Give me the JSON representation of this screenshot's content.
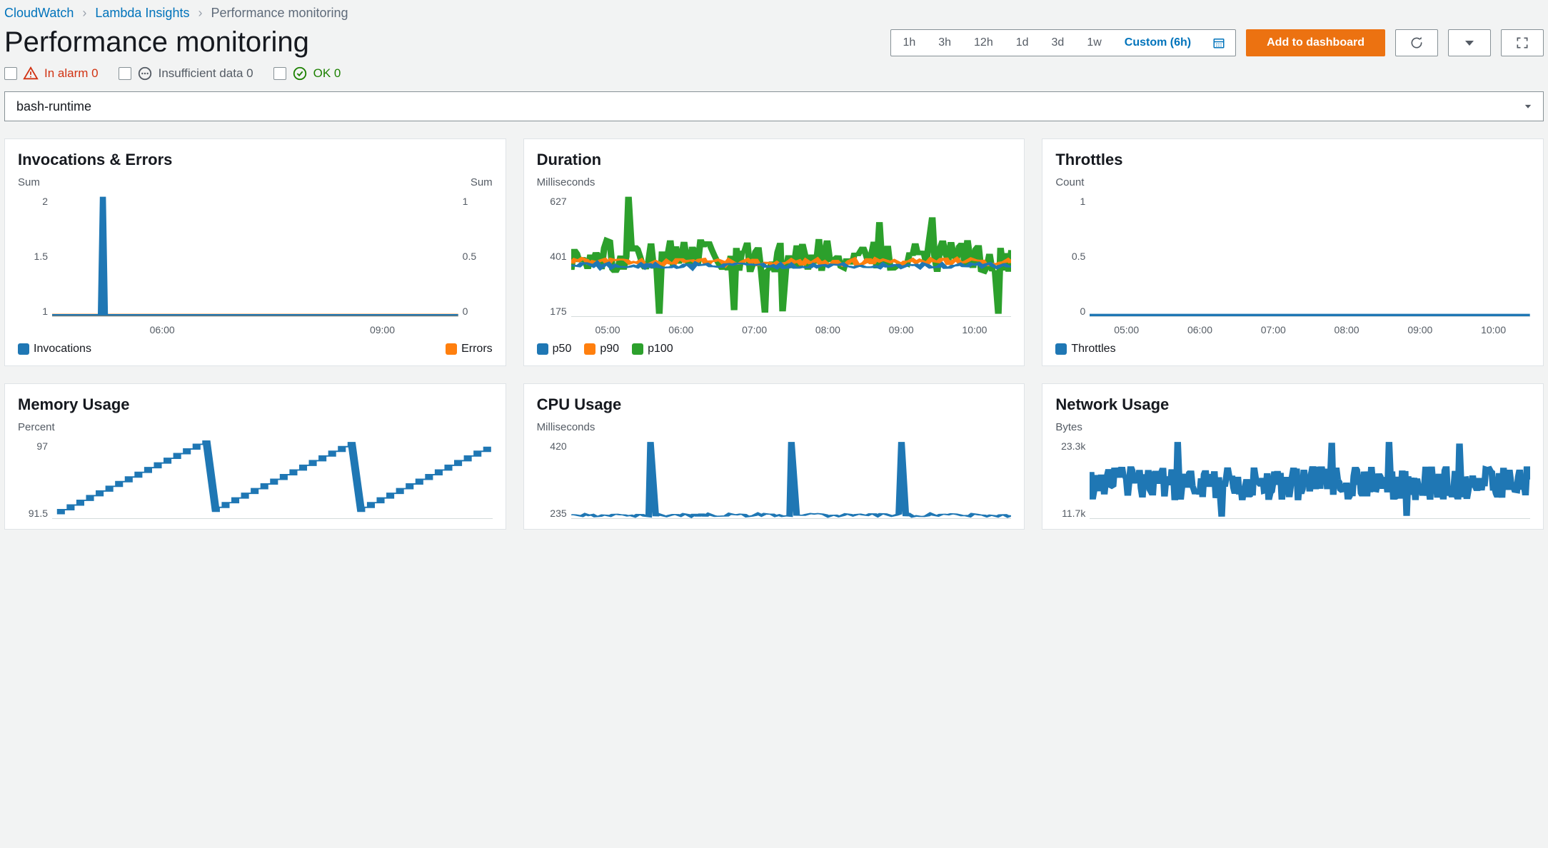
{
  "breadcrumb": {
    "items": [
      "CloudWatch",
      "Lambda Insights"
    ],
    "current": "Performance monitoring"
  },
  "page_title": "Performance monitoring",
  "time_range": {
    "options": [
      "1h",
      "3h",
      "12h",
      "1d",
      "3d",
      "1w"
    ],
    "custom_label": "Custom (6h)"
  },
  "actions": {
    "add_to_dashboard": "Add to dashboard"
  },
  "alarm_status": {
    "in_alarm": {
      "label": "In alarm",
      "count": 0
    },
    "insufficient": {
      "label": "Insufficient data",
      "count": 0
    },
    "ok": {
      "label": "OK",
      "count": 0
    }
  },
  "function_select": {
    "value": "bash-runtime"
  },
  "colors": {
    "blue": "#1f77b4",
    "orange": "#ff7f0e",
    "green": "#2ca02c"
  },
  "cards": {
    "invocations": {
      "title": "Invocations & Errors",
      "yleft_label": "Sum",
      "yright_label": "Sum",
      "yleft_ticks": [
        "2",
        "1.5",
        "1"
      ],
      "yright_ticks": [
        "1",
        "0.5",
        "0"
      ],
      "x_ticks": [
        "06:00",
        "09:00"
      ],
      "legend": [
        {
          "name": "Invocations",
          "color_key": "blue"
        },
        {
          "name": "Errors",
          "color_key": "orange"
        }
      ]
    },
    "duration": {
      "title": "Duration",
      "ylabel": "Milliseconds",
      "y_ticks": [
        "627",
        "401",
        "175"
      ],
      "x_ticks": [
        "05:00",
        "06:00",
        "07:00",
        "08:00",
        "09:00",
        "10:00"
      ],
      "legend": [
        {
          "name": "p50",
          "color_key": "blue"
        },
        {
          "name": "p90",
          "color_key": "orange"
        },
        {
          "name": "p100",
          "color_key": "green"
        }
      ]
    },
    "throttles": {
      "title": "Throttles",
      "ylabel": "Count",
      "y_ticks": [
        "1",
        "0.5",
        "0"
      ],
      "x_ticks": [
        "05:00",
        "06:00",
        "07:00",
        "08:00",
        "09:00",
        "10:00"
      ],
      "legend": [
        {
          "name": "Throttles",
          "color_key": "blue"
        }
      ]
    },
    "memory": {
      "title": "Memory Usage",
      "ylabel": "Percent",
      "y_ticks": [
        "97",
        "91.5"
      ]
    },
    "cpu": {
      "title": "CPU Usage",
      "ylabel": "Milliseconds",
      "y_ticks": [
        "420",
        "235"
      ]
    },
    "network": {
      "title": "Network Usage",
      "ylabel": "Bytes",
      "y_ticks": [
        "23.3k",
        "11.7k"
      ]
    }
  },
  "chart_data": [
    {
      "id": "invocations",
      "type": "line",
      "title": "Invocations & Errors",
      "x_range_hours": [
        "05:00",
        "11:00"
      ],
      "series": [
        {
          "name": "Invocations",
          "yaxis": "left",
          "note": "constant 1 with single spike to 2 at ~05:45",
          "points": [
            [
              0,
              1
            ],
            [
              0.12,
              1
            ],
            [
              0.125,
              2
            ],
            [
              0.13,
              1
            ],
            [
              1,
              1
            ]
          ]
        },
        {
          "name": "Errors",
          "yaxis": "right",
          "note": "constant 0",
          "points": [
            [
              0,
              0
            ],
            [
              1,
              0
            ]
          ]
        }
      ],
      "yleft_range": [
        1,
        2
      ],
      "yright_range": [
        0,
        1
      ]
    },
    {
      "id": "duration",
      "type": "line",
      "title": "Duration",
      "ylabel": "Milliseconds",
      "y_range": [
        175,
        627
      ],
      "x_ticks": [
        "05:00",
        "06:00",
        "07:00",
        "08:00",
        "09:00",
        "10:00"
      ],
      "series": [
        {
          "name": "p50",
          "approx_mean": 380
        },
        {
          "name": "p90",
          "approx_mean": 400
        },
        {
          "name": "p100",
          "approx_mean": 410,
          "note": "noisy; spikes up to ~627, dips down to ~175"
        }
      ]
    },
    {
      "id": "throttles",
      "type": "line",
      "title": "Throttles",
      "ylabel": "Count",
      "y_range": [
        0,
        1
      ],
      "x_ticks": [
        "05:00",
        "06:00",
        "07:00",
        "08:00",
        "09:00",
        "10:00"
      ],
      "series": [
        {
          "name": "Throttles",
          "constant": 0
        }
      ]
    },
    {
      "id": "memory",
      "type": "line",
      "title": "Memory Usage",
      "ylabel": "Percent",
      "y_range": [
        86,
        97
      ],
      "note": "two rising staircase segments from ~88 to 97, then drop back and repeat"
    },
    {
      "id": "cpu",
      "type": "line",
      "title": "CPU Usage",
      "ylabel": "Milliseconds",
      "y_range": [
        50,
        420
      ],
      "note": "baseline near 50 with narrow spikes up to ~420 roughly hourly"
    },
    {
      "id": "network",
      "type": "line",
      "title": "Network Usage",
      "ylabel": "Bytes",
      "y_range": [
        0,
        23300
      ],
      "note": "highly noisy around ~11.7k with occasional spikes to ~23.3k"
    }
  ]
}
